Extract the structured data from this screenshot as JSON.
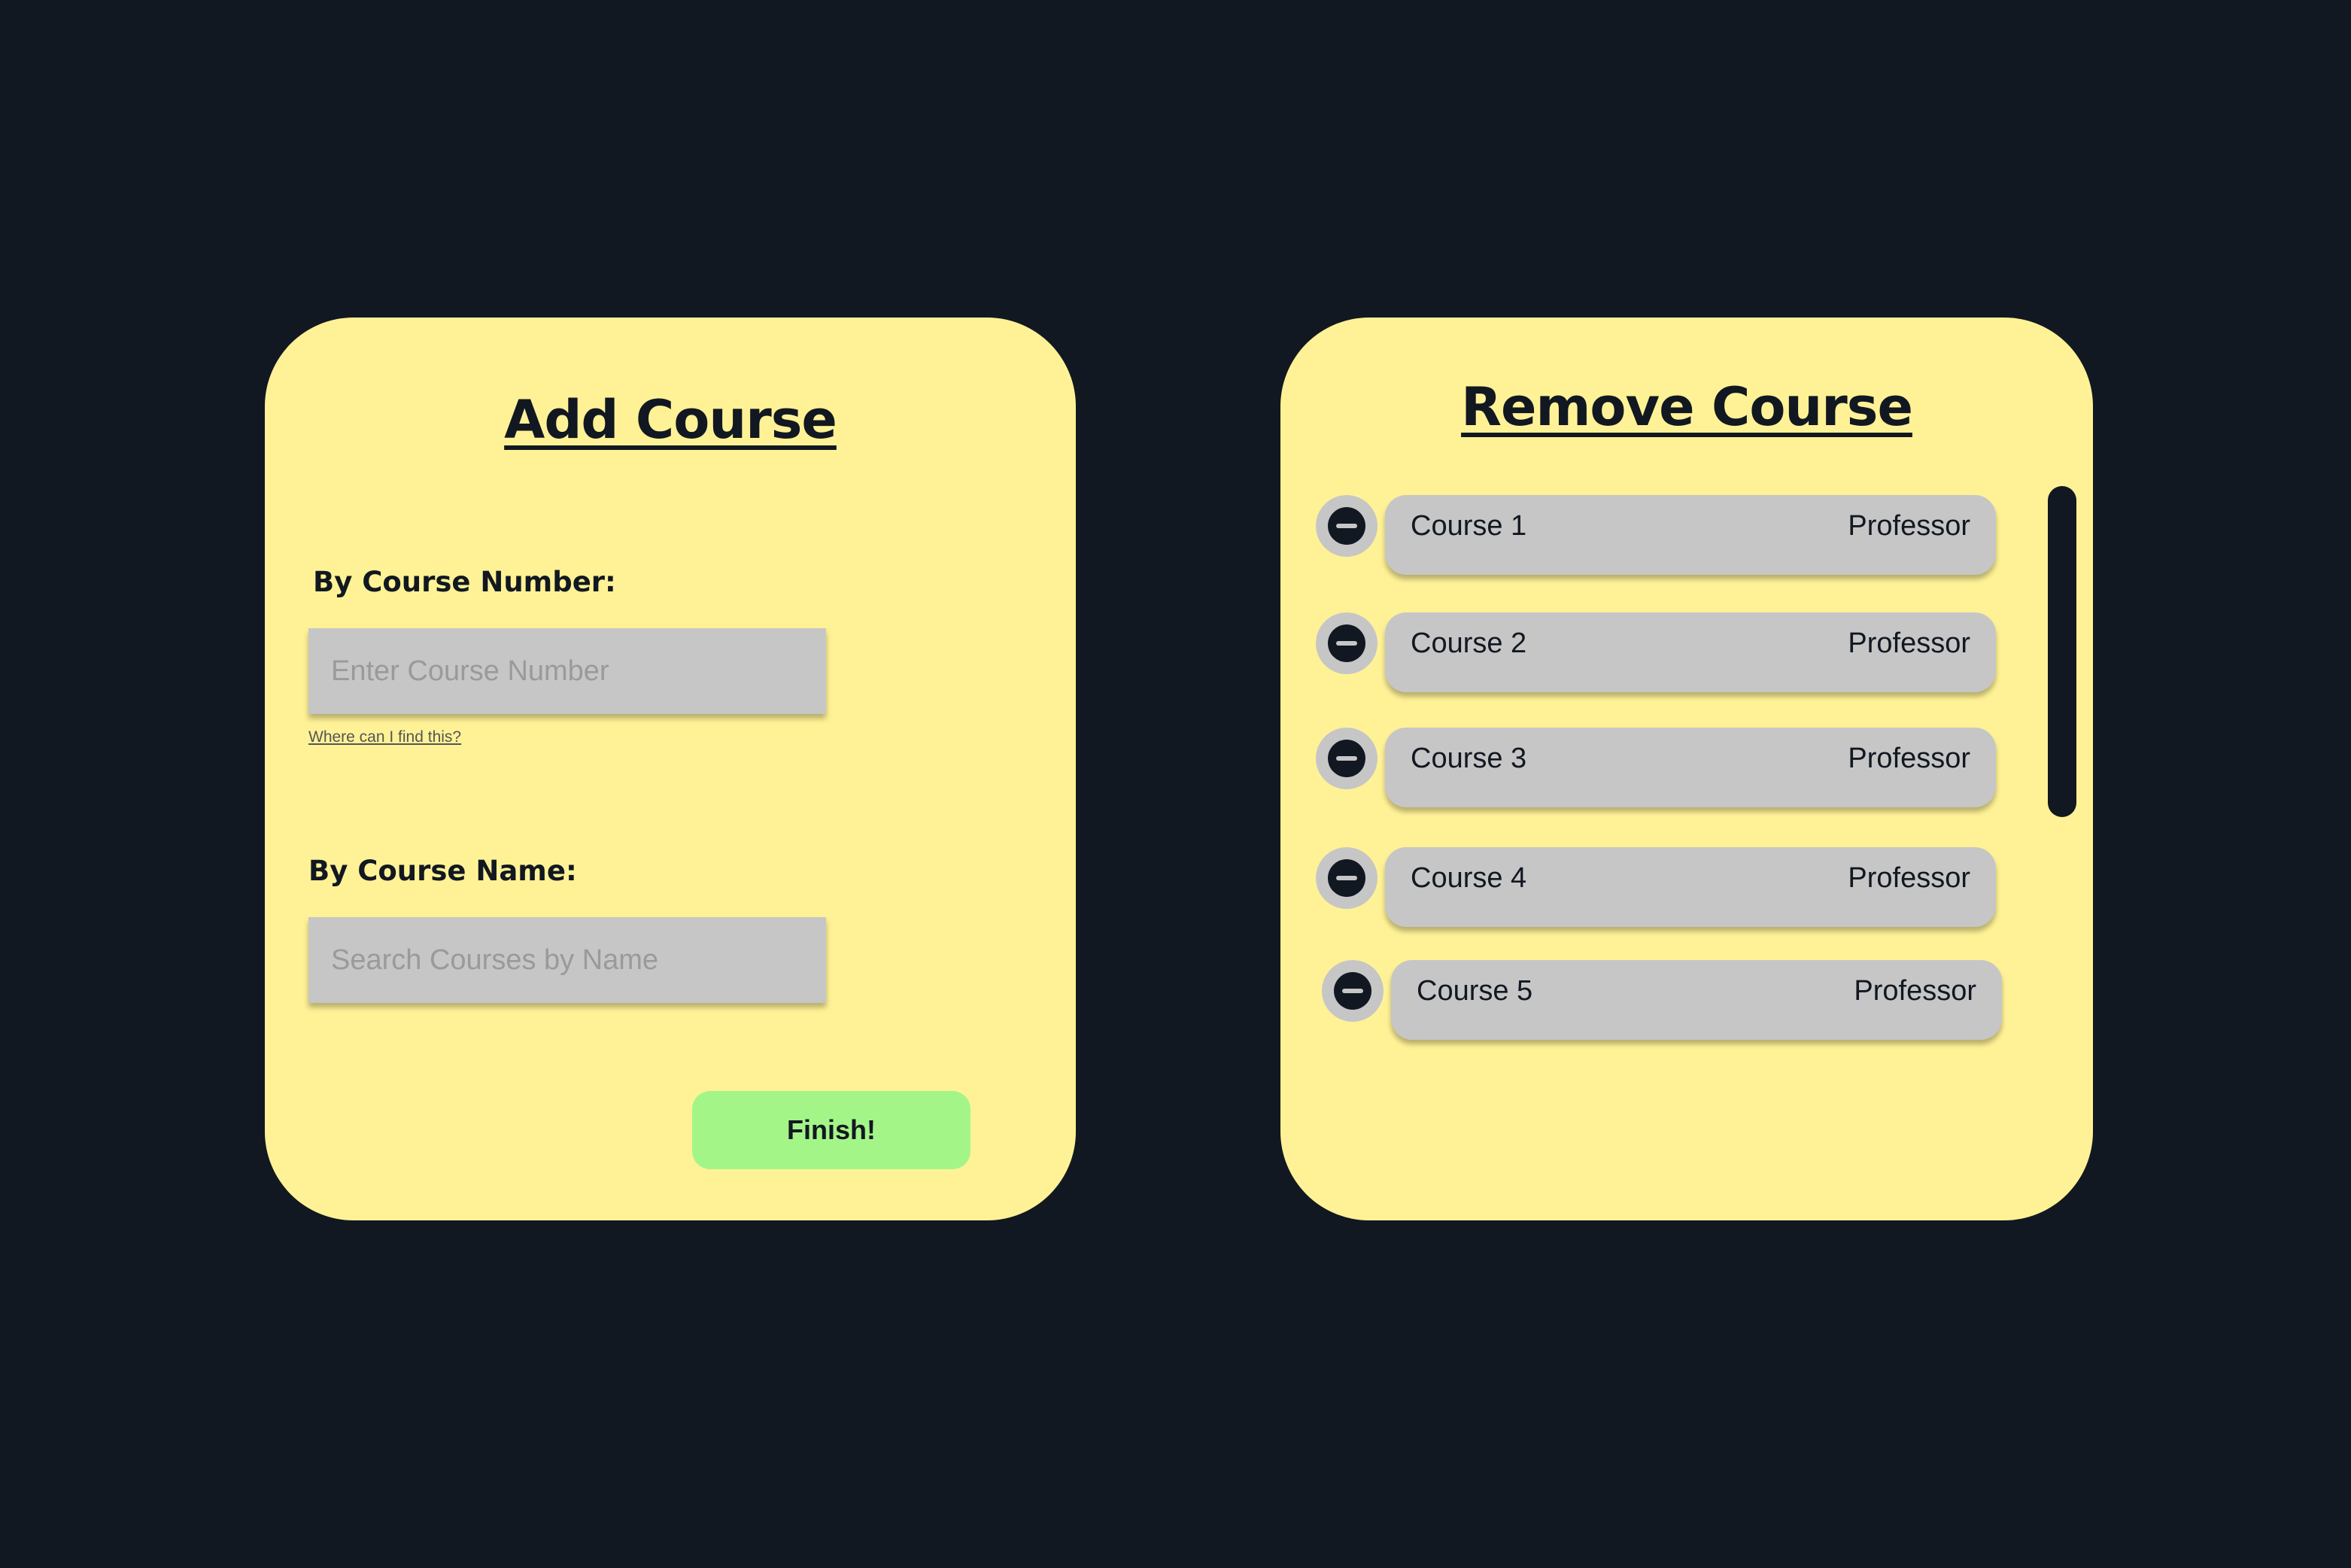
{
  "add_course": {
    "title": "Add Course",
    "number_label": "By Course Number:",
    "number_placeholder": "Enter Course Number",
    "help_link": "Where can I find this?",
    "name_label": "By Course Name:",
    "name_placeholder": "Search Courses by Name",
    "finish_label": "Finish!"
  },
  "remove_course": {
    "title": "Remove Course",
    "courses": [
      {
        "name": "Course 1",
        "professor": "Professor"
      },
      {
        "name": "Course 2",
        "professor": "Professor"
      },
      {
        "name": "Course 3",
        "professor": "Professor"
      },
      {
        "name": "Course 4",
        "professor": "Professor"
      },
      {
        "name": "Course 5",
        "professor": "Professor"
      }
    ]
  },
  "colors": {
    "background": "#121821",
    "card": "#FFF296",
    "field": "#C6C6C6",
    "finish_button": "#A4F588",
    "text": "#121821"
  },
  "icons": {
    "remove": "minus-circle-icon"
  }
}
